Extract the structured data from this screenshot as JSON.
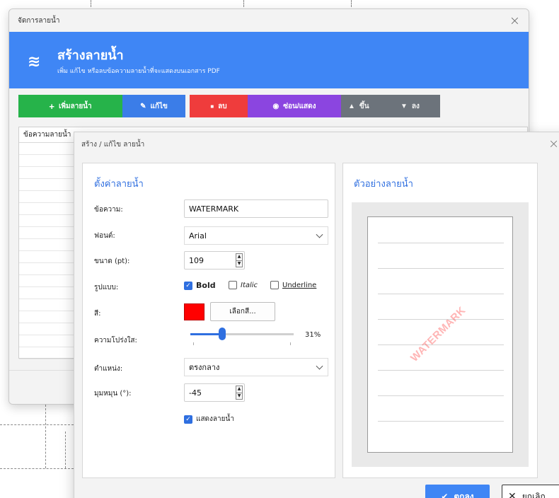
{
  "background_window": {
    "title": "จัดการลายน้ำ",
    "close": "×",
    "hero": {
      "icon": "≋",
      "title": "สร้างลายน้ำ",
      "subtitle": "เพิ่ม แก้ไข หรือลบข้อความลายน้ำที่จะแสดงบนเอกสาร PDF"
    },
    "toolbar": {
      "add": {
        "icon": "+",
        "label": "เพิ่มลายน้ำ"
      },
      "edit": {
        "icon": "✎",
        "label": "แก้ไข"
      },
      "delete": {
        "icon": "■",
        "label": "ลบ"
      },
      "toggle": {
        "icon": "◉",
        "label": "ซ่อน/แสดง"
      },
      "up": {
        "icon": "▲",
        "label": "ขึ้น"
      },
      "down": {
        "icon": "▼",
        "label": "ลง"
      }
    },
    "grid": {
      "column_header": "ข้อความลายน้ำ"
    }
  },
  "dialog": {
    "title": "สร้าง / แก้ไข ลายน้ำ",
    "close": "×",
    "settings": {
      "heading": "ตั้งค่าลายน้ำ",
      "text_label": "ข้อความ:",
      "text_value": "WATERMARK",
      "font_label": "ฟอนต์:",
      "font_value": "Arial",
      "size_label": "ขนาด (pt):",
      "size_value": "109",
      "style_label": "รูปแบบ:",
      "bold_label": "Bold",
      "bold_checked": true,
      "italic_label": "Italic",
      "italic_checked": false,
      "underline_label": "Underline",
      "underline_checked": false,
      "color_label": "สี:",
      "color_value": "#ff0000",
      "pick_color_label": "เลือกสี...",
      "opacity_label": "ความโปร่งใส:",
      "opacity_value": 0.31,
      "opacity_text": "31%",
      "position_label": "ตำแหน่ง:",
      "position_value": "ตรงกลาง",
      "rotation_label": "มุมหมุน (°):",
      "rotation_value": "-45",
      "show_label": "แสดงลายน้ำ",
      "show_checked": true
    },
    "preview": {
      "heading": "ตัวอย่างลายน้ำ",
      "watermark_text": "WATERMARK",
      "watermark_color": "#ff3c3c"
    },
    "ok": {
      "icon": "✔",
      "label": "ตกลง"
    },
    "cancel": {
      "icon": "✕",
      "label": "ยกเลิก"
    }
  }
}
